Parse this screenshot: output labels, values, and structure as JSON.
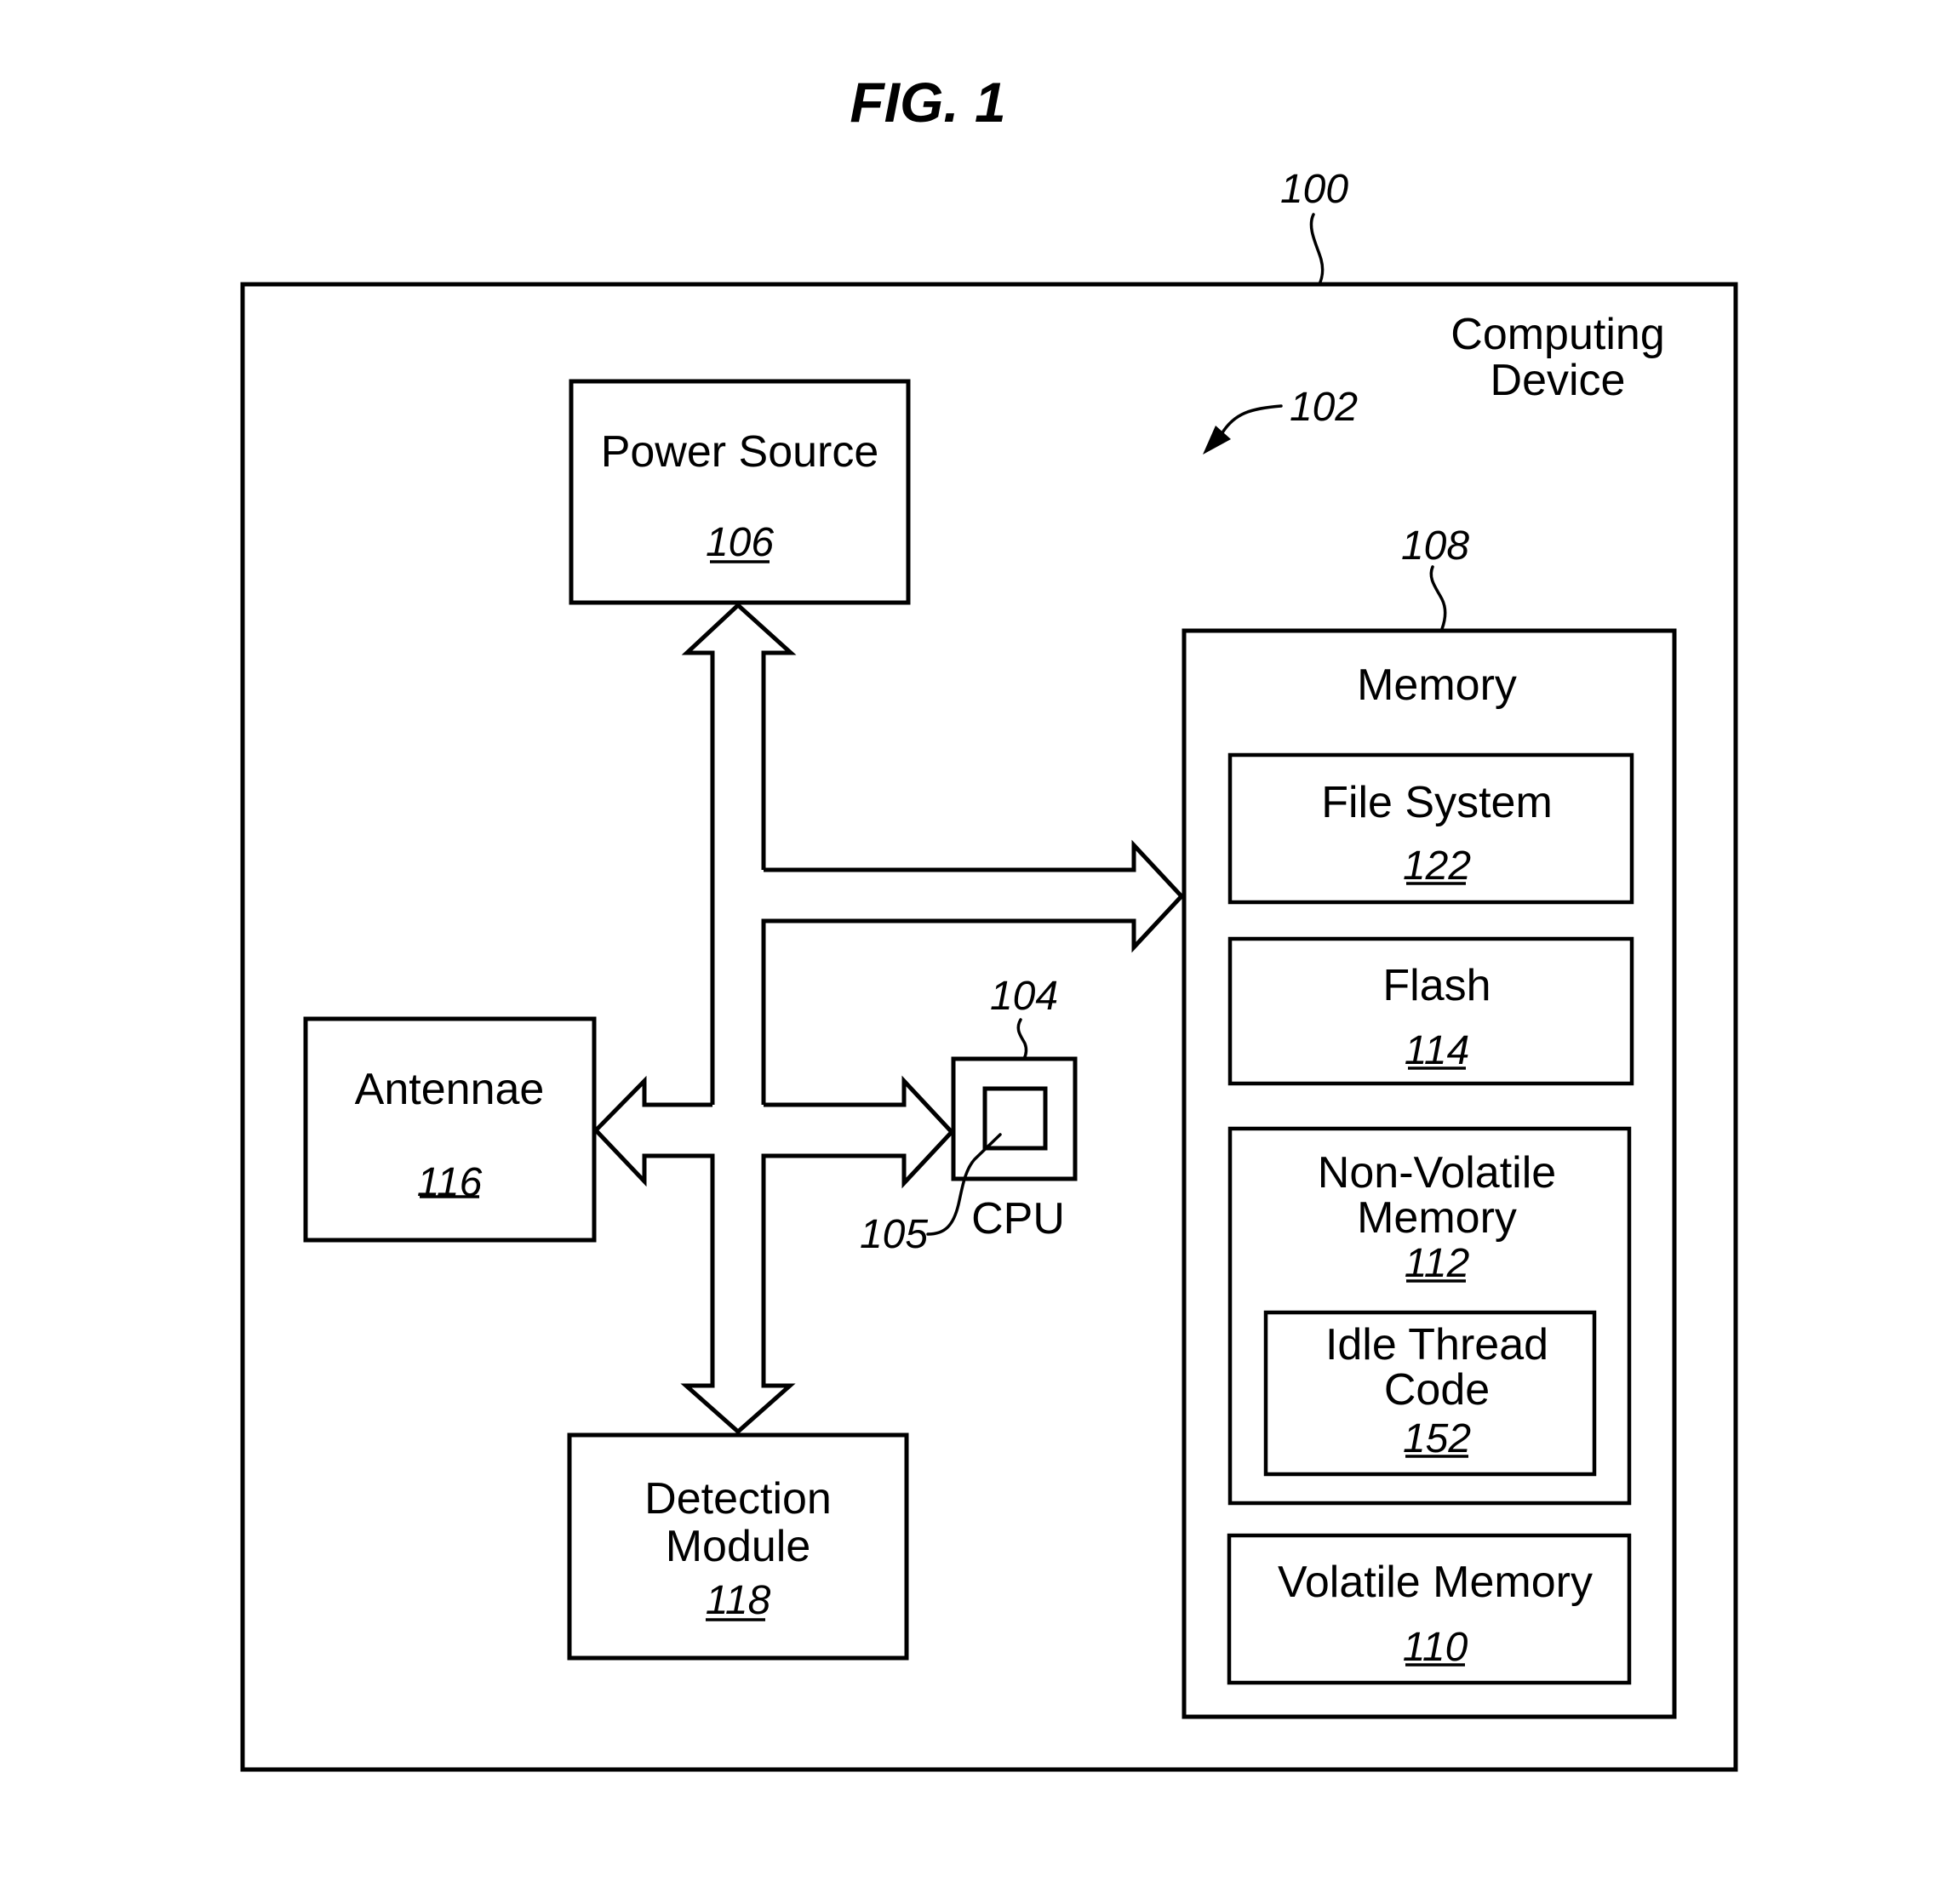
{
  "figure": {
    "title": "FIG. 1",
    "ref_device": "100",
    "ref_system": "102",
    "device_label_line1": "Computing",
    "device_label_line2": "Device"
  },
  "components": {
    "power_source": {
      "label": "Power Source",
      "ref": "106"
    },
    "antennae": {
      "label": "Antennae",
      "ref": "116"
    },
    "detection_module": {
      "label_line1": "Detection",
      "label_line2": "Module",
      "ref": "118"
    },
    "cpu": {
      "label": "CPU",
      "ref": "104",
      "core_ref": "105"
    },
    "memory": {
      "label": "Memory",
      "ref": "108",
      "file_system": {
        "label": "File System",
        "ref": "122"
      },
      "flash": {
        "label": "Flash",
        "ref": "114"
      },
      "non_volatile": {
        "label_line1": "Non-Volatile",
        "label_line2": "Memory",
        "ref": "112",
        "idle_thread": {
          "label_line1": "Idle Thread",
          "label_line2": "Code",
          "ref": "152"
        }
      },
      "volatile": {
        "label": "Volatile Memory",
        "ref": "110"
      }
    }
  },
  "bus": {
    "connections": [
      "power_source",
      "memory",
      "cpu",
      "antennae",
      "detection_module"
    ]
  }
}
